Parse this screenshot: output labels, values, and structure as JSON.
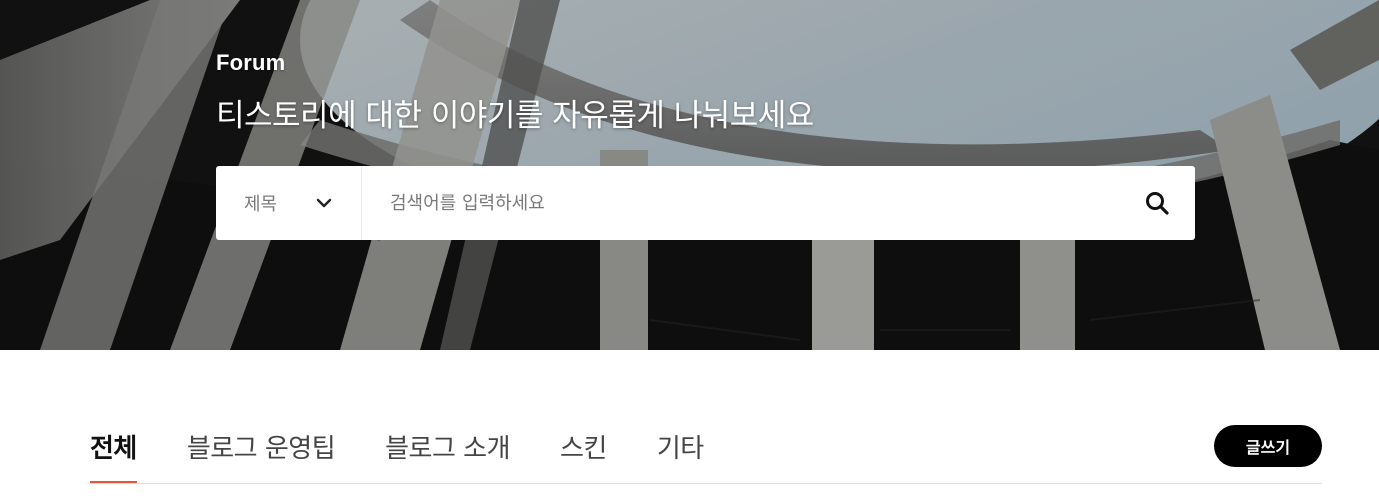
{
  "hero": {
    "label": "Forum",
    "title": "티스토리에 대한 이야기를 자유롭게 나눠보세요"
  },
  "search": {
    "select_value": "제목",
    "placeholder": "검색어를 입력하세요",
    "search_icon": "search-icon",
    "chevron_icon": "chevron-down-icon"
  },
  "tabs": [
    {
      "label": "전체",
      "active": true
    },
    {
      "label": "블로그 운영팁",
      "active": false
    },
    {
      "label": "블로그 소개",
      "active": false
    },
    {
      "label": "스킨",
      "active": false
    },
    {
      "label": "기타",
      "active": false
    }
  ],
  "write_button": {
    "label": "글쓰기"
  },
  "colors": {
    "accent_underline": "#e8563a",
    "write_button_bg": "#000000"
  }
}
